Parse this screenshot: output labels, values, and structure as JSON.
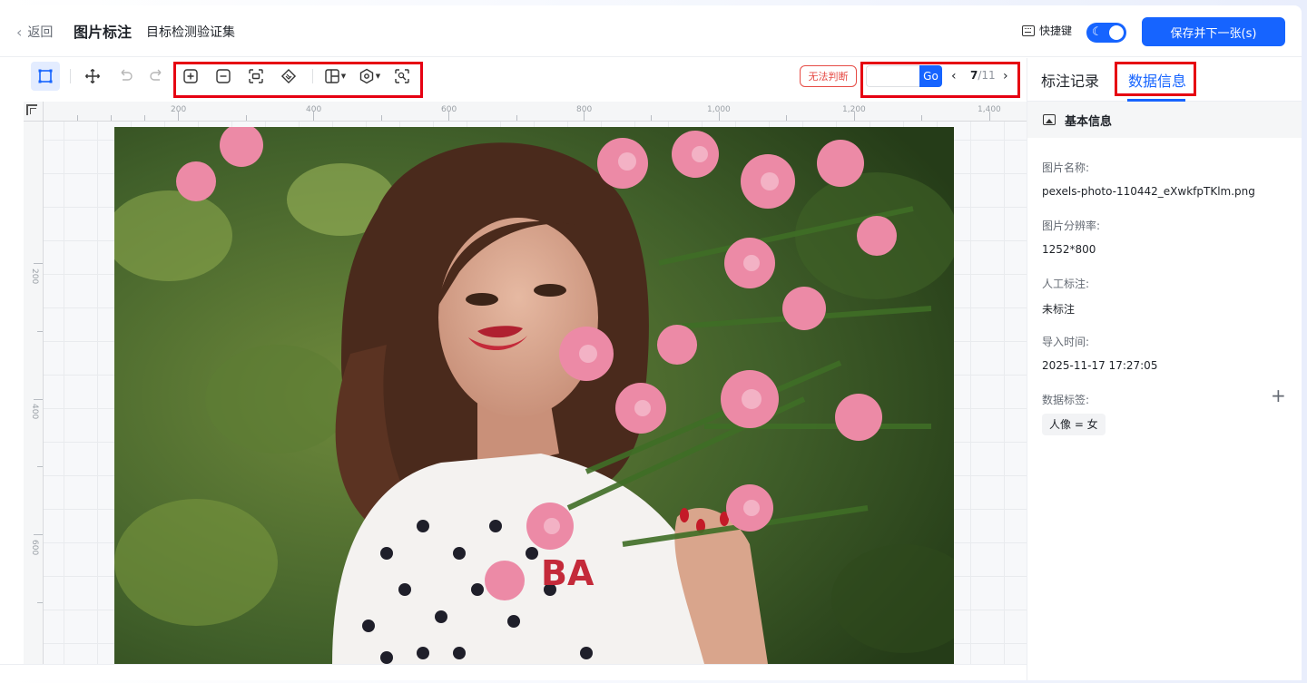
{
  "header": {
    "back_label": "返回",
    "page_title": "图片标注",
    "dataset_name": "目标检测验证集",
    "shortcut_label": "快捷键",
    "save_next_label": "保存并下一张(s)"
  },
  "toolbar": {
    "cannot_judge_label": "无法判断",
    "go_input_value": "",
    "go_label": "Go",
    "page_current": "7",
    "page_separator": "/",
    "page_total": "11"
  },
  "ruler": {
    "top_ticks": [
      "200",
      "400",
      "600",
      "800",
      "1,000",
      "1,200",
      "1,400"
    ],
    "left_ticks": [
      "200",
      "400",
      "600"
    ]
  },
  "panel": {
    "tabs": [
      {
        "label": "标注记录"
      },
      {
        "label": "数据信息"
      }
    ],
    "section_title": "基本信息",
    "fields": [
      {
        "label": "图片名称:",
        "value": "pexels-photo-110442_eXwkfpTKlm.png"
      },
      {
        "label": "图片分辨率:",
        "value": "1252*800"
      },
      {
        "label": "人工标注:",
        "value": "未标注"
      },
      {
        "label": "导入时间:",
        "value": "2025-11-17 17:27:05"
      }
    ],
    "tags_label": "数据标签:",
    "tags": [
      "人像 = 女"
    ]
  },
  "colors": {
    "accent": "#1664ff",
    "highlight_box": "#e60012",
    "warning": "#e64b45"
  }
}
